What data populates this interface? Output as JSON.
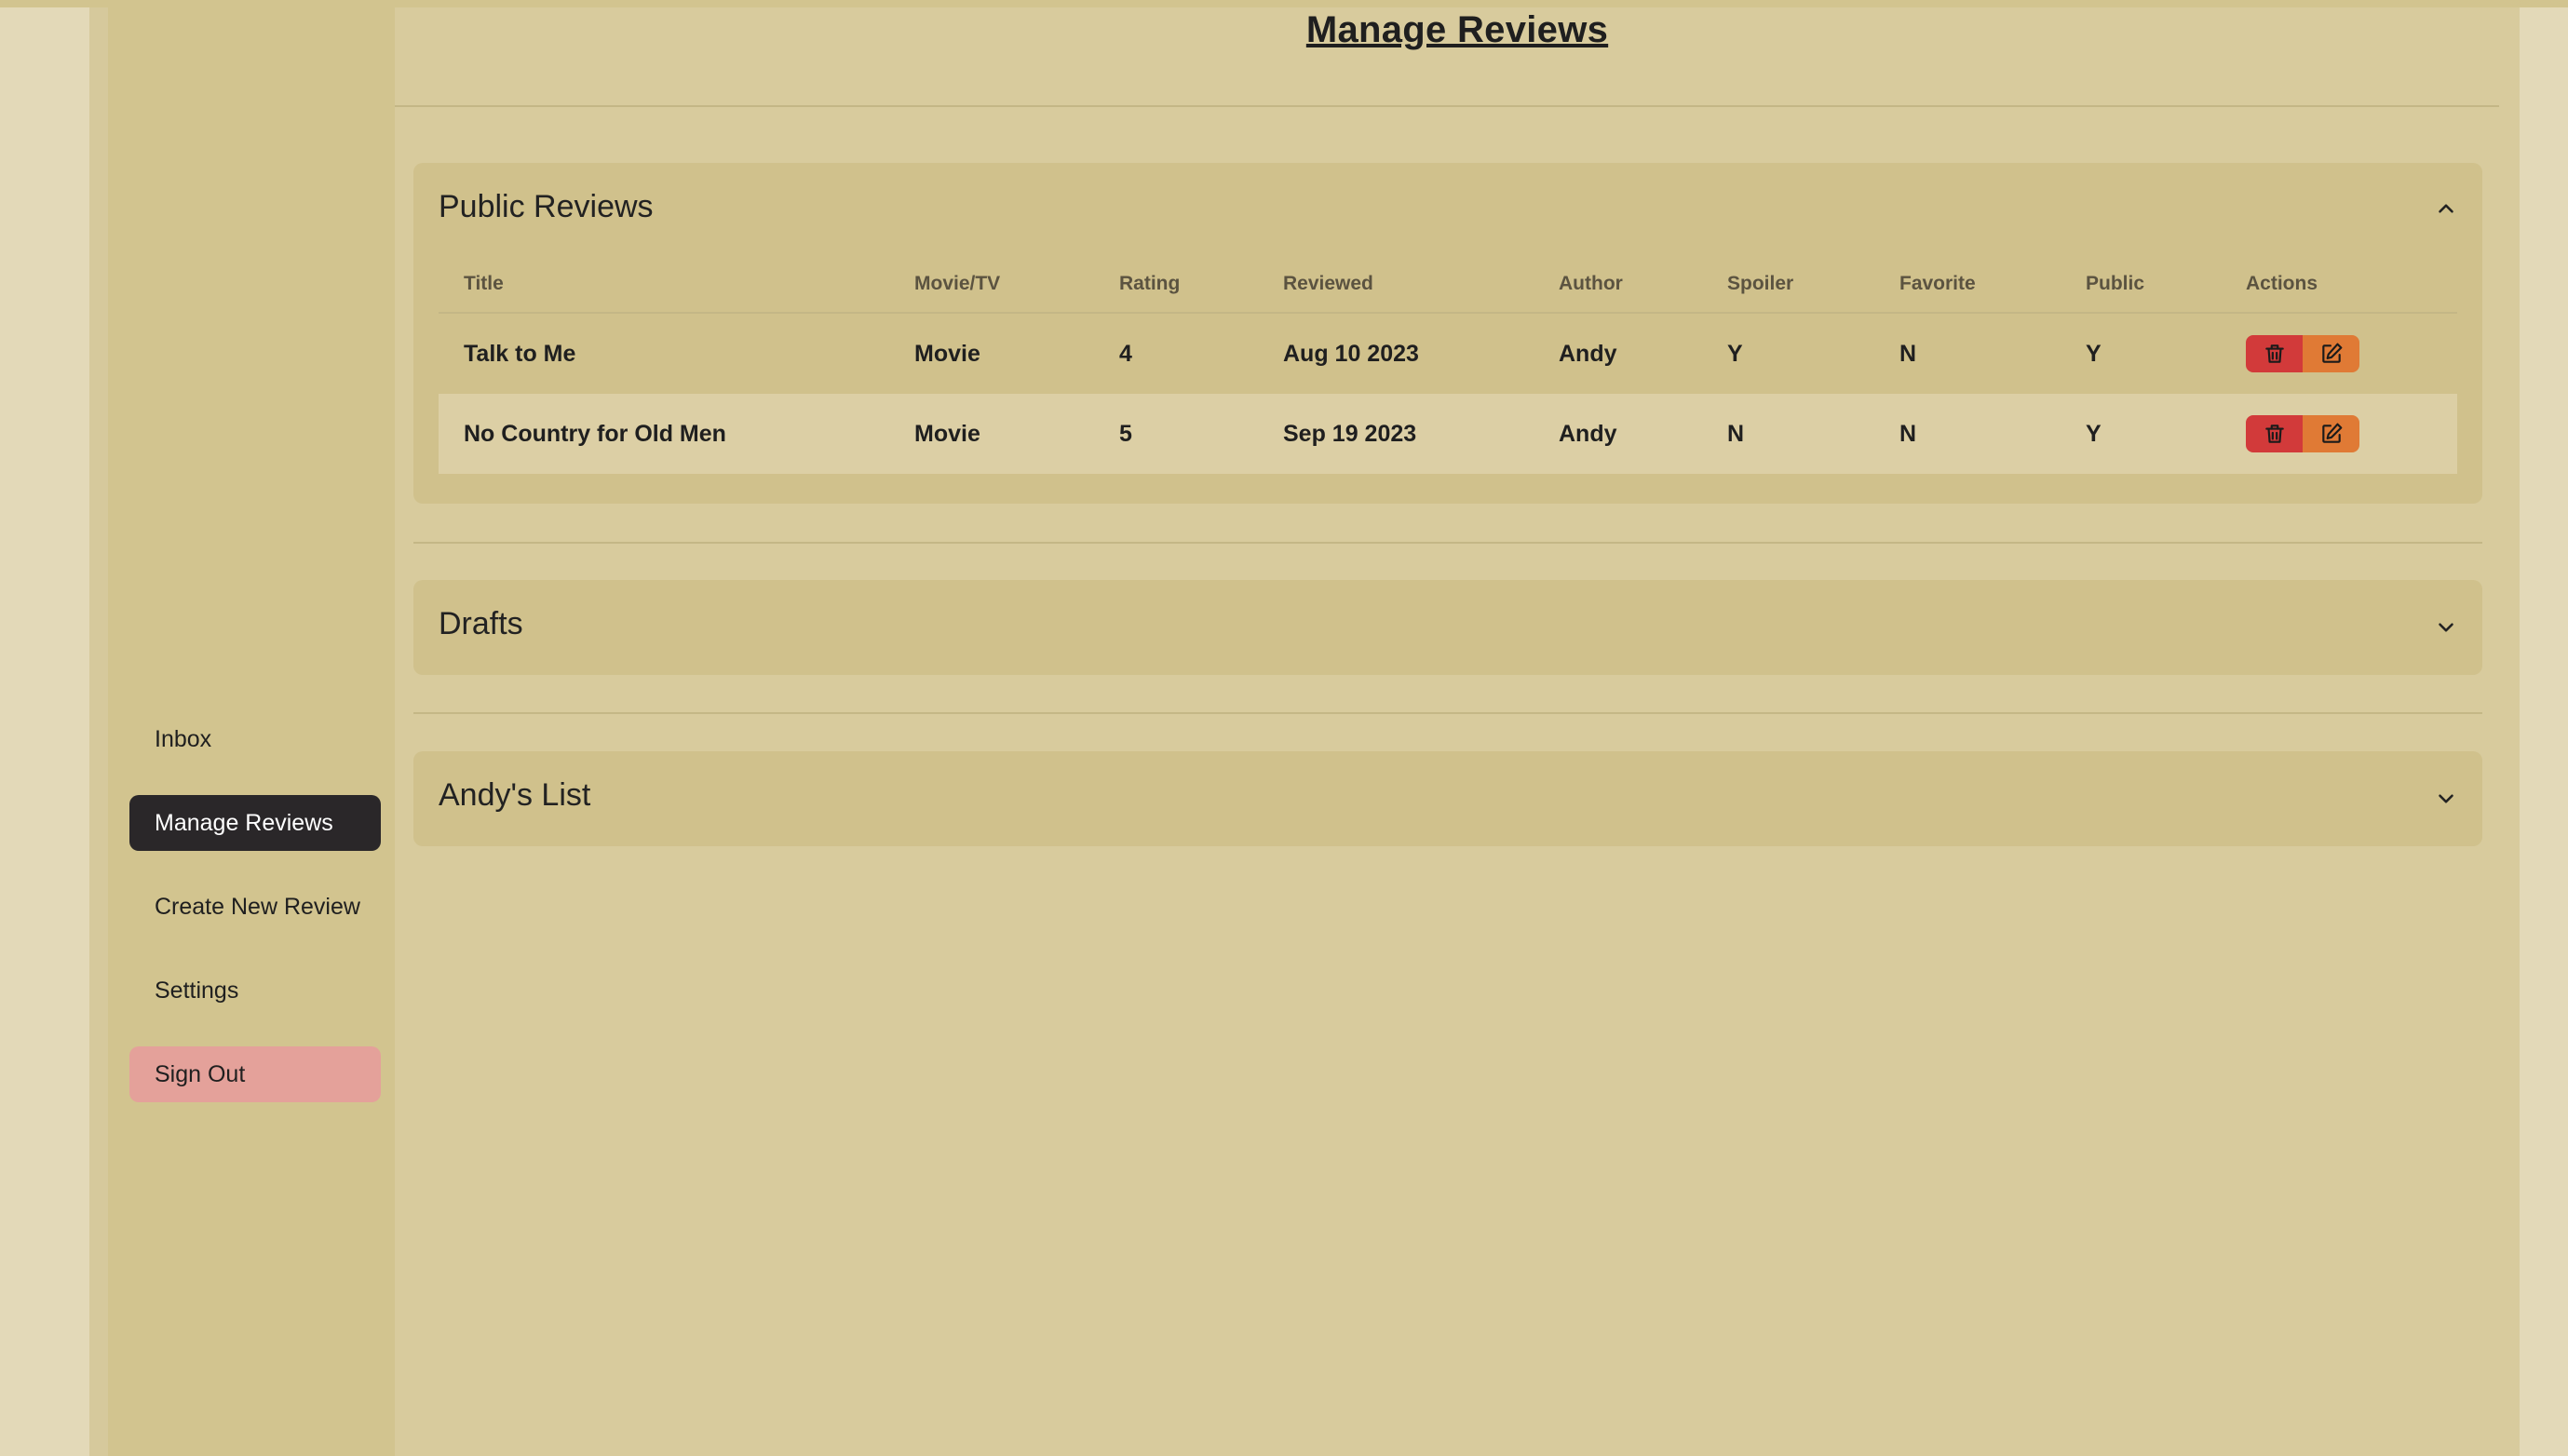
{
  "page": {
    "title": "Manage Reviews"
  },
  "sidebar": {
    "items": [
      {
        "label": "Inbox"
      },
      {
        "label": "Manage Reviews",
        "active": true
      },
      {
        "label": "Create New Review"
      },
      {
        "label": "Settings"
      },
      {
        "label": "Sign Out"
      }
    ]
  },
  "sections": {
    "public_reviews": {
      "title": "Public Reviews",
      "expanded": true,
      "columns": [
        "Title",
        "Movie/TV",
        "Rating",
        "Reviewed",
        "Author",
        "Spoiler",
        "Favorite",
        "Public",
        "Actions"
      ],
      "rows": [
        {
          "title": "Talk to Me",
          "type": "Movie",
          "rating": "4",
          "reviewed": "Aug 10 2023",
          "author": "Andy",
          "spoiler": "Y",
          "favorite": "N",
          "public": "Y"
        },
        {
          "title": "No Country for Old Men",
          "type": "Movie",
          "rating": "5",
          "reviewed": "Sep 19 2023",
          "author": "Andy",
          "spoiler": "N",
          "favorite": "N",
          "public": "Y"
        }
      ]
    },
    "drafts": {
      "title": "Drafts",
      "expanded": false
    },
    "list": {
      "title": "Andy's List",
      "expanded": false
    }
  },
  "icons": {
    "delete": "trash-icon",
    "edit": "edit-icon",
    "expand": "chevron-down-icon",
    "collapse": "chevron-up-icon"
  },
  "colors": {
    "background": "#e3d9b8",
    "sidebar": "#d2c48f",
    "main": "#d8cb9d",
    "panel": "#d0c18c",
    "active_nav": "#2a2729",
    "sign_out": "#e4a19a",
    "delete_button": "#d23a3a",
    "edit_button": "#e07a35"
  }
}
